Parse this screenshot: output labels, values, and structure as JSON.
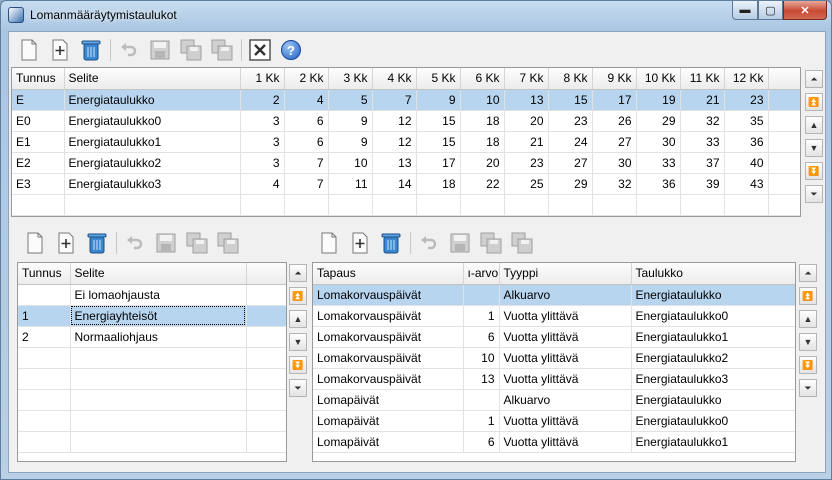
{
  "window": {
    "title": "Lomanmääräytymistaulukot",
    "min_glyph": "▬",
    "max_glyph": "▢",
    "close_glyph": "✕"
  },
  "main_toolbar": {
    "help_glyph": "?"
  },
  "main_table": {
    "columns": [
      "Tunnus",
      "Selite",
      "1 Kk",
      "2 Kk",
      "3 Kk",
      "4 Kk",
      "5 Kk",
      "6 Kk",
      "7 Kk",
      "8 Kk",
      "9 Kk",
      "10 Kk",
      "11 Kk",
      "12 Kk"
    ],
    "rows": [
      {
        "tunnus": "E",
        "selite": "Energiataulukko",
        "v": [
          "2",
          "4",
          "5",
          "7",
          "9",
          "10",
          "13",
          "15",
          "17",
          "19",
          "21",
          "23"
        ]
      },
      {
        "tunnus": "E0",
        "selite": "Energiataulukko0",
        "v": [
          "3",
          "6",
          "9",
          "12",
          "15",
          "18",
          "20",
          "23",
          "26",
          "29",
          "32",
          "35"
        ]
      },
      {
        "tunnus": "E1",
        "selite": "Energiataulukko1",
        "v": [
          "3",
          "6",
          "9",
          "12",
          "15",
          "18",
          "21",
          "24",
          "27",
          "30",
          "33",
          "36"
        ]
      },
      {
        "tunnus": "E2",
        "selite": "Energiataulukko2",
        "v": [
          "3",
          "7",
          "10",
          "13",
          "17",
          "20",
          "23",
          "27",
          "30",
          "33",
          "37",
          "40"
        ]
      },
      {
        "tunnus": "E3",
        "selite": "Energiataulukko3",
        "v": [
          "4",
          "7",
          "11",
          "14",
          "18",
          "22",
          "25",
          "29",
          "32",
          "36",
          "39",
          "43"
        ]
      }
    ]
  },
  "left_table": {
    "columns": [
      "Tunnus",
      "Selite"
    ],
    "rows": [
      {
        "tunnus": "",
        "selite": "Ei lomaohjausta"
      },
      {
        "tunnus": "1",
        "selite": "Energiayhteisöt"
      },
      {
        "tunnus": "2",
        "selite": "Normaaliohjaus"
      }
    ]
  },
  "right_table": {
    "columns": [
      "Tapaus",
      "ı-arvo",
      "Tyyppi",
      "Taulukko"
    ],
    "rows": [
      {
        "tapaus": "Lomakorvauspäivät",
        "arvo": "",
        "tyyppi": "Alkuarvo",
        "taulukko": "Energiataulukko"
      },
      {
        "tapaus": "Lomakorvauspäivät",
        "arvo": "1",
        "tyyppi": "Vuotta ylittävä",
        "taulukko": "Energiataulukko0"
      },
      {
        "tapaus": "Lomakorvauspäivät",
        "arvo": "6",
        "tyyppi": "Vuotta ylittävä",
        "taulukko": "Energiataulukko1"
      },
      {
        "tapaus": "Lomakorvauspäivät",
        "arvo": "10",
        "tyyppi": "Vuotta ylittävä",
        "taulukko": "Energiataulukko2"
      },
      {
        "tapaus": "Lomakorvauspäivät",
        "arvo": "13",
        "tyyppi": "Vuotta ylittävä",
        "taulukko": "Energiataulukko3"
      },
      {
        "tapaus": "Lomapäivät",
        "arvo": "",
        "tyyppi": "Alkuarvo",
        "taulukko": "Energiataulukko"
      },
      {
        "tapaus": "Lomapäivät",
        "arvo": "1",
        "tyyppi": "Vuotta ylittävä",
        "taulukko": "Energiataulukko0"
      },
      {
        "tapaus": "Lomapäivät",
        "arvo": "6",
        "tyyppi": "Vuotta ylittävä",
        "taulukko": "Energiataulukko1"
      }
    ]
  },
  "nav_glyphs": {
    "first": "⏶",
    "page_up": "⏫",
    "up": "▲",
    "down": "▼",
    "page_down": "⏬",
    "last": "⏷"
  }
}
